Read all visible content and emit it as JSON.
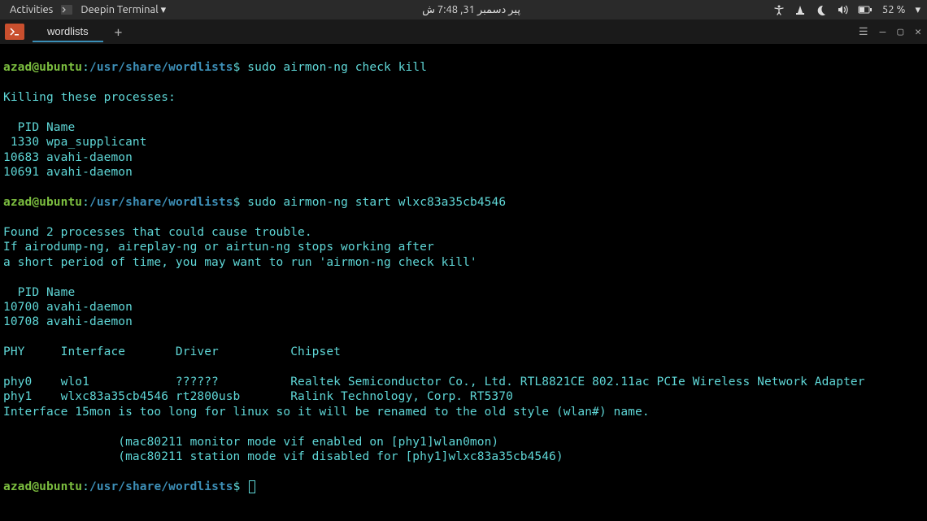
{
  "topbar": {
    "activities": "Activities",
    "app_name": "Deepin Terminal",
    "clock": "پیر دسمبر 31, 7:48 ش",
    "battery": "52 %"
  },
  "tabbar": {
    "tab_label": "wordlists"
  },
  "term": {
    "prompt_user": "azad@ubuntu",
    "prompt_colon": ":",
    "prompt_path": "/usr/share/wordlists",
    "prompt_dollar": "$",
    "cmd1": "sudo airmon-ng check kill",
    "l1": "Killing these processes:",
    "l2": "  PID Name",
    "l3": " 1330 wpa_supplicant",
    "l4": "10683 avahi-daemon",
    "l5": "10691 avahi-daemon",
    "cmd2": "sudo airmon-ng start wlxc83a35cb4546",
    "l6": "Found 2 processes that could cause trouble.",
    "l7": "If airodump-ng, aireplay-ng or airtun-ng stops working after",
    "l8": "a short period of time, you may want to run 'airmon-ng check kill'",
    "l9": "  PID Name",
    "l10": "10700 avahi-daemon",
    "l11": "10708 avahi-daemon",
    "l12": "PHY     Interface       Driver          Chipset",
    "l13": "phy0    wlo1            ??????          Realtek Semiconductor Co., Ltd. RTL8821CE 802.11ac PCIe Wireless Network Adapter",
    "l14": "phy1    wlxc83a35cb4546 rt2800usb       Ralink Technology, Corp. RT5370",
    "l15": "Interface 15mon is too long for linux so it will be renamed to the old style (wlan#) name.",
    "l16": "                (mac80211 monitor mode vif enabled on [phy1]wlan0mon)",
    "l17": "                (mac80211 station mode vif disabled for [phy1]wlxc83a35cb4546)"
  }
}
